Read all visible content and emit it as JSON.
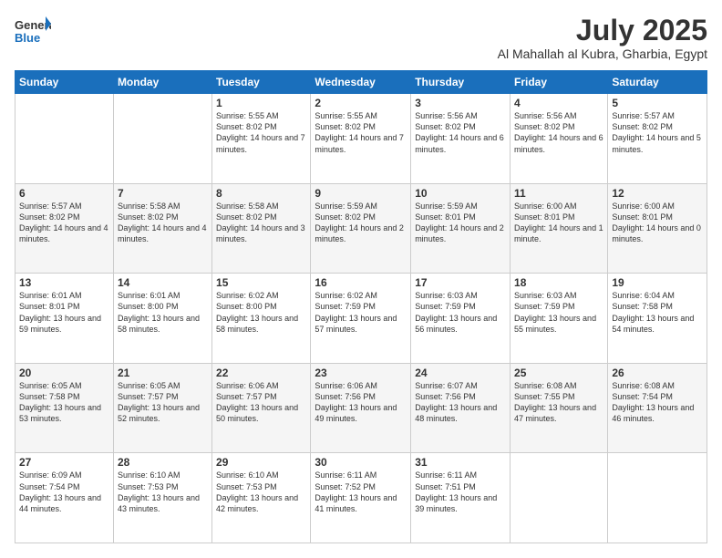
{
  "header": {
    "logo_general": "General",
    "logo_blue": "Blue",
    "month": "July 2025",
    "location": "Al Mahallah al Kubra, Gharbia, Egypt"
  },
  "weekdays": [
    "Sunday",
    "Monday",
    "Tuesday",
    "Wednesday",
    "Thursday",
    "Friday",
    "Saturday"
  ],
  "weeks": [
    [
      {
        "day": "",
        "info": ""
      },
      {
        "day": "",
        "info": ""
      },
      {
        "day": "1",
        "info": "Sunrise: 5:55 AM\nSunset: 8:02 PM\nDaylight: 14 hours and 7 minutes."
      },
      {
        "day": "2",
        "info": "Sunrise: 5:55 AM\nSunset: 8:02 PM\nDaylight: 14 hours and 7 minutes."
      },
      {
        "day": "3",
        "info": "Sunrise: 5:56 AM\nSunset: 8:02 PM\nDaylight: 14 hours and 6 minutes."
      },
      {
        "day": "4",
        "info": "Sunrise: 5:56 AM\nSunset: 8:02 PM\nDaylight: 14 hours and 6 minutes."
      },
      {
        "day": "5",
        "info": "Sunrise: 5:57 AM\nSunset: 8:02 PM\nDaylight: 14 hours and 5 minutes."
      }
    ],
    [
      {
        "day": "6",
        "info": "Sunrise: 5:57 AM\nSunset: 8:02 PM\nDaylight: 14 hours and 4 minutes."
      },
      {
        "day": "7",
        "info": "Sunrise: 5:58 AM\nSunset: 8:02 PM\nDaylight: 14 hours and 4 minutes."
      },
      {
        "day": "8",
        "info": "Sunrise: 5:58 AM\nSunset: 8:02 PM\nDaylight: 14 hours and 3 minutes."
      },
      {
        "day": "9",
        "info": "Sunrise: 5:59 AM\nSunset: 8:02 PM\nDaylight: 14 hours and 2 minutes."
      },
      {
        "day": "10",
        "info": "Sunrise: 5:59 AM\nSunset: 8:01 PM\nDaylight: 14 hours and 2 minutes."
      },
      {
        "day": "11",
        "info": "Sunrise: 6:00 AM\nSunset: 8:01 PM\nDaylight: 14 hours and 1 minute."
      },
      {
        "day": "12",
        "info": "Sunrise: 6:00 AM\nSunset: 8:01 PM\nDaylight: 14 hours and 0 minutes."
      }
    ],
    [
      {
        "day": "13",
        "info": "Sunrise: 6:01 AM\nSunset: 8:01 PM\nDaylight: 13 hours and 59 minutes."
      },
      {
        "day": "14",
        "info": "Sunrise: 6:01 AM\nSunset: 8:00 PM\nDaylight: 13 hours and 58 minutes."
      },
      {
        "day": "15",
        "info": "Sunrise: 6:02 AM\nSunset: 8:00 PM\nDaylight: 13 hours and 58 minutes."
      },
      {
        "day": "16",
        "info": "Sunrise: 6:02 AM\nSunset: 7:59 PM\nDaylight: 13 hours and 57 minutes."
      },
      {
        "day": "17",
        "info": "Sunrise: 6:03 AM\nSunset: 7:59 PM\nDaylight: 13 hours and 56 minutes."
      },
      {
        "day": "18",
        "info": "Sunrise: 6:03 AM\nSunset: 7:59 PM\nDaylight: 13 hours and 55 minutes."
      },
      {
        "day": "19",
        "info": "Sunrise: 6:04 AM\nSunset: 7:58 PM\nDaylight: 13 hours and 54 minutes."
      }
    ],
    [
      {
        "day": "20",
        "info": "Sunrise: 6:05 AM\nSunset: 7:58 PM\nDaylight: 13 hours and 53 minutes."
      },
      {
        "day": "21",
        "info": "Sunrise: 6:05 AM\nSunset: 7:57 PM\nDaylight: 13 hours and 52 minutes."
      },
      {
        "day": "22",
        "info": "Sunrise: 6:06 AM\nSunset: 7:57 PM\nDaylight: 13 hours and 50 minutes."
      },
      {
        "day": "23",
        "info": "Sunrise: 6:06 AM\nSunset: 7:56 PM\nDaylight: 13 hours and 49 minutes."
      },
      {
        "day": "24",
        "info": "Sunrise: 6:07 AM\nSunset: 7:56 PM\nDaylight: 13 hours and 48 minutes."
      },
      {
        "day": "25",
        "info": "Sunrise: 6:08 AM\nSunset: 7:55 PM\nDaylight: 13 hours and 47 minutes."
      },
      {
        "day": "26",
        "info": "Sunrise: 6:08 AM\nSunset: 7:54 PM\nDaylight: 13 hours and 46 minutes."
      }
    ],
    [
      {
        "day": "27",
        "info": "Sunrise: 6:09 AM\nSunset: 7:54 PM\nDaylight: 13 hours and 44 minutes."
      },
      {
        "day": "28",
        "info": "Sunrise: 6:10 AM\nSunset: 7:53 PM\nDaylight: 13 hours and 43 minutes."
      },
      {
        "day": "29",
        "info": "Sunrise: 6:10 AM\nSunset: 7:53 PM\nDaylight: 13 hours and 42 minutes."
      },
      {
        "day": "30",
        "info": "Sunrise: 6:11 AM\nSunset: 7:52 PM\nDaylight: 13 hours and 41 minutes."
      },
      {
        "day": "31",
        "info": "Sunrise: 6:11 AM\nSunset: 7:51 PM\nDaylight: 13 hours and 39 minutes."
      },
      {
        "day": "",
        "info": ""
      },
      {
        "day": "",
        "info": ""
      }
    ]
  ]
}
